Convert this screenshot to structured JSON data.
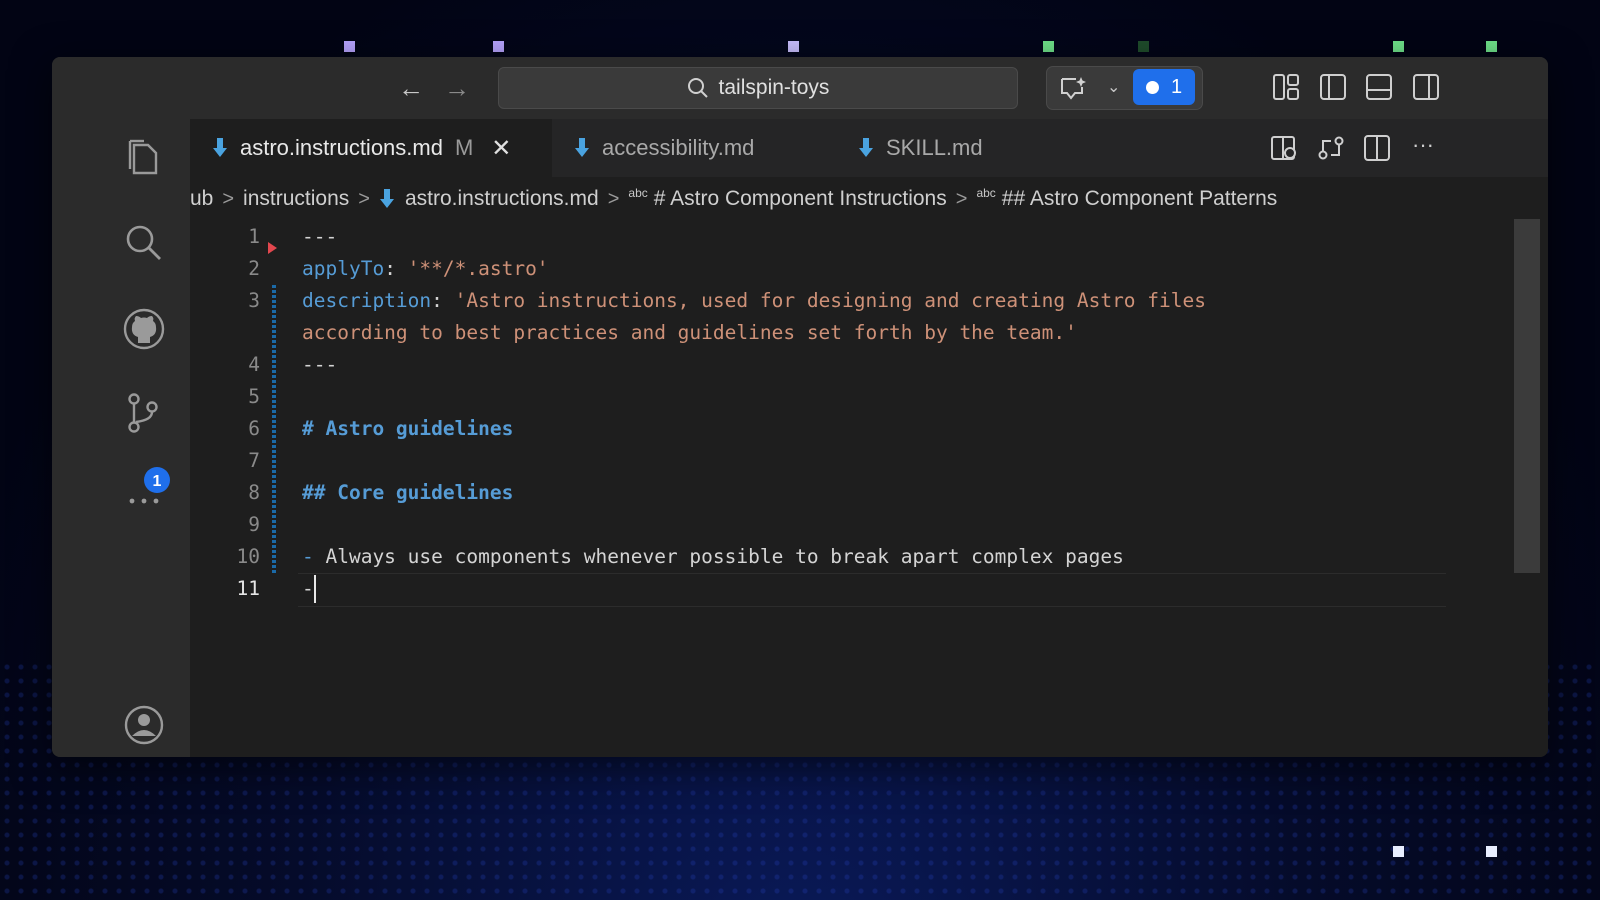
{
  "titlebar": {
    "back_icon": "arrow-left-icon",
    "forward_icon": "arrow-right-icon",
    "search_text": "tailspin-toys",
    "chat_icon": "chat-sparkle-icon",
    "notification_count": "1"
  },
  "tabs": [
    {
      "label": "astro.instructions.md",
      "status": "M",
      "active": true
    },
    {
      "label": "accessibility.md",
      "active": false
    },
    {
      "label": "SKILL.md",
      "active": false
    }
  ],
  "breadcrumb": {
    "items": [
      "ub",
      "instructions",
      "astro.instructions.md",
      "# Astro Component Instructions",
      "## Astro Component Patterns"
    ],
    "symbol_prefix": "abc"
  },
  "activity_bar": {
    "items": [
      "files-icon",
      "search-icon",
      "github-icon",
      "source-control-icon",
      "more-icon"
    ],
    "source_control_badge": "1",
    "bottom": [
      "account-icon",
      "settings-icon"
    ]
  },
  "editor": {
    "lines": [
      {
        "num": "1",
        "tokens": [
          {
            "t": "---",
            "c": "plain"
          }
        ]
      },
      {
        "num": "2",
        "tokens": [
          {
            "t": "applyTo",
            "c": "key"
          },
          {
            "t": ": ",
            "c": "plain"
          },
          {
            "t": "'**/*.astro'",
            "c": "str"
          }
        ]
      },
      {
        "num": "3",
        "tokens": [
          {
            "t": "description",
            "c": "key"
          },
          {
            "t": ": ",
            "c": "plain"
          },
          {
            "t": "'Astro instructions, used for designing and creating Astro files",
            "c": "str"
          }
        ]
      },
      {
        "num": "",
        "tokens": [
          {
            "t": "according to best practices and guidelines set forth by the team.'",
            "c": "str"
          }
        ]
      },
      {
        "num": "4",
        "tokens": [
          {
            "t": "---",
            "c": "plain"
          }
        ]
      },
      {
        "num": "5",
        "tokens": []
      },
      {
        "num": "6",
        "tokens": [
          {
            "t": "# Astro guidelines",
            "c": "head"
          }
        ]
      },
      {
        "num": "7",
        "tokens": []
      },
      {
        "num": "8",
        "tokens": [
          {
            "t": "## Core guidelines",
            "c": "head"
          }
        ]
      },
      {
        "num": "9",
        "tokens": []
      },
      {
        "num": "10",
        "tokens": [
          {
            "t": "- ",
            "c": "key"
          },
          {
            "t": "Always use components whenever possible to break apart complex pages",
            "c": "plain"
          }
        ]
      },
      {
        "num": "11",
        "tokens": [
          {
            "t": "-",
            "c": "plain"
          }
        ]
      }
    ],
    "current_line": "11"
  },
  "colors": {
    "accent": "#1f6feb",
    "keyword": "#569cd6",
    "string": "#ce9178"
  }
}
